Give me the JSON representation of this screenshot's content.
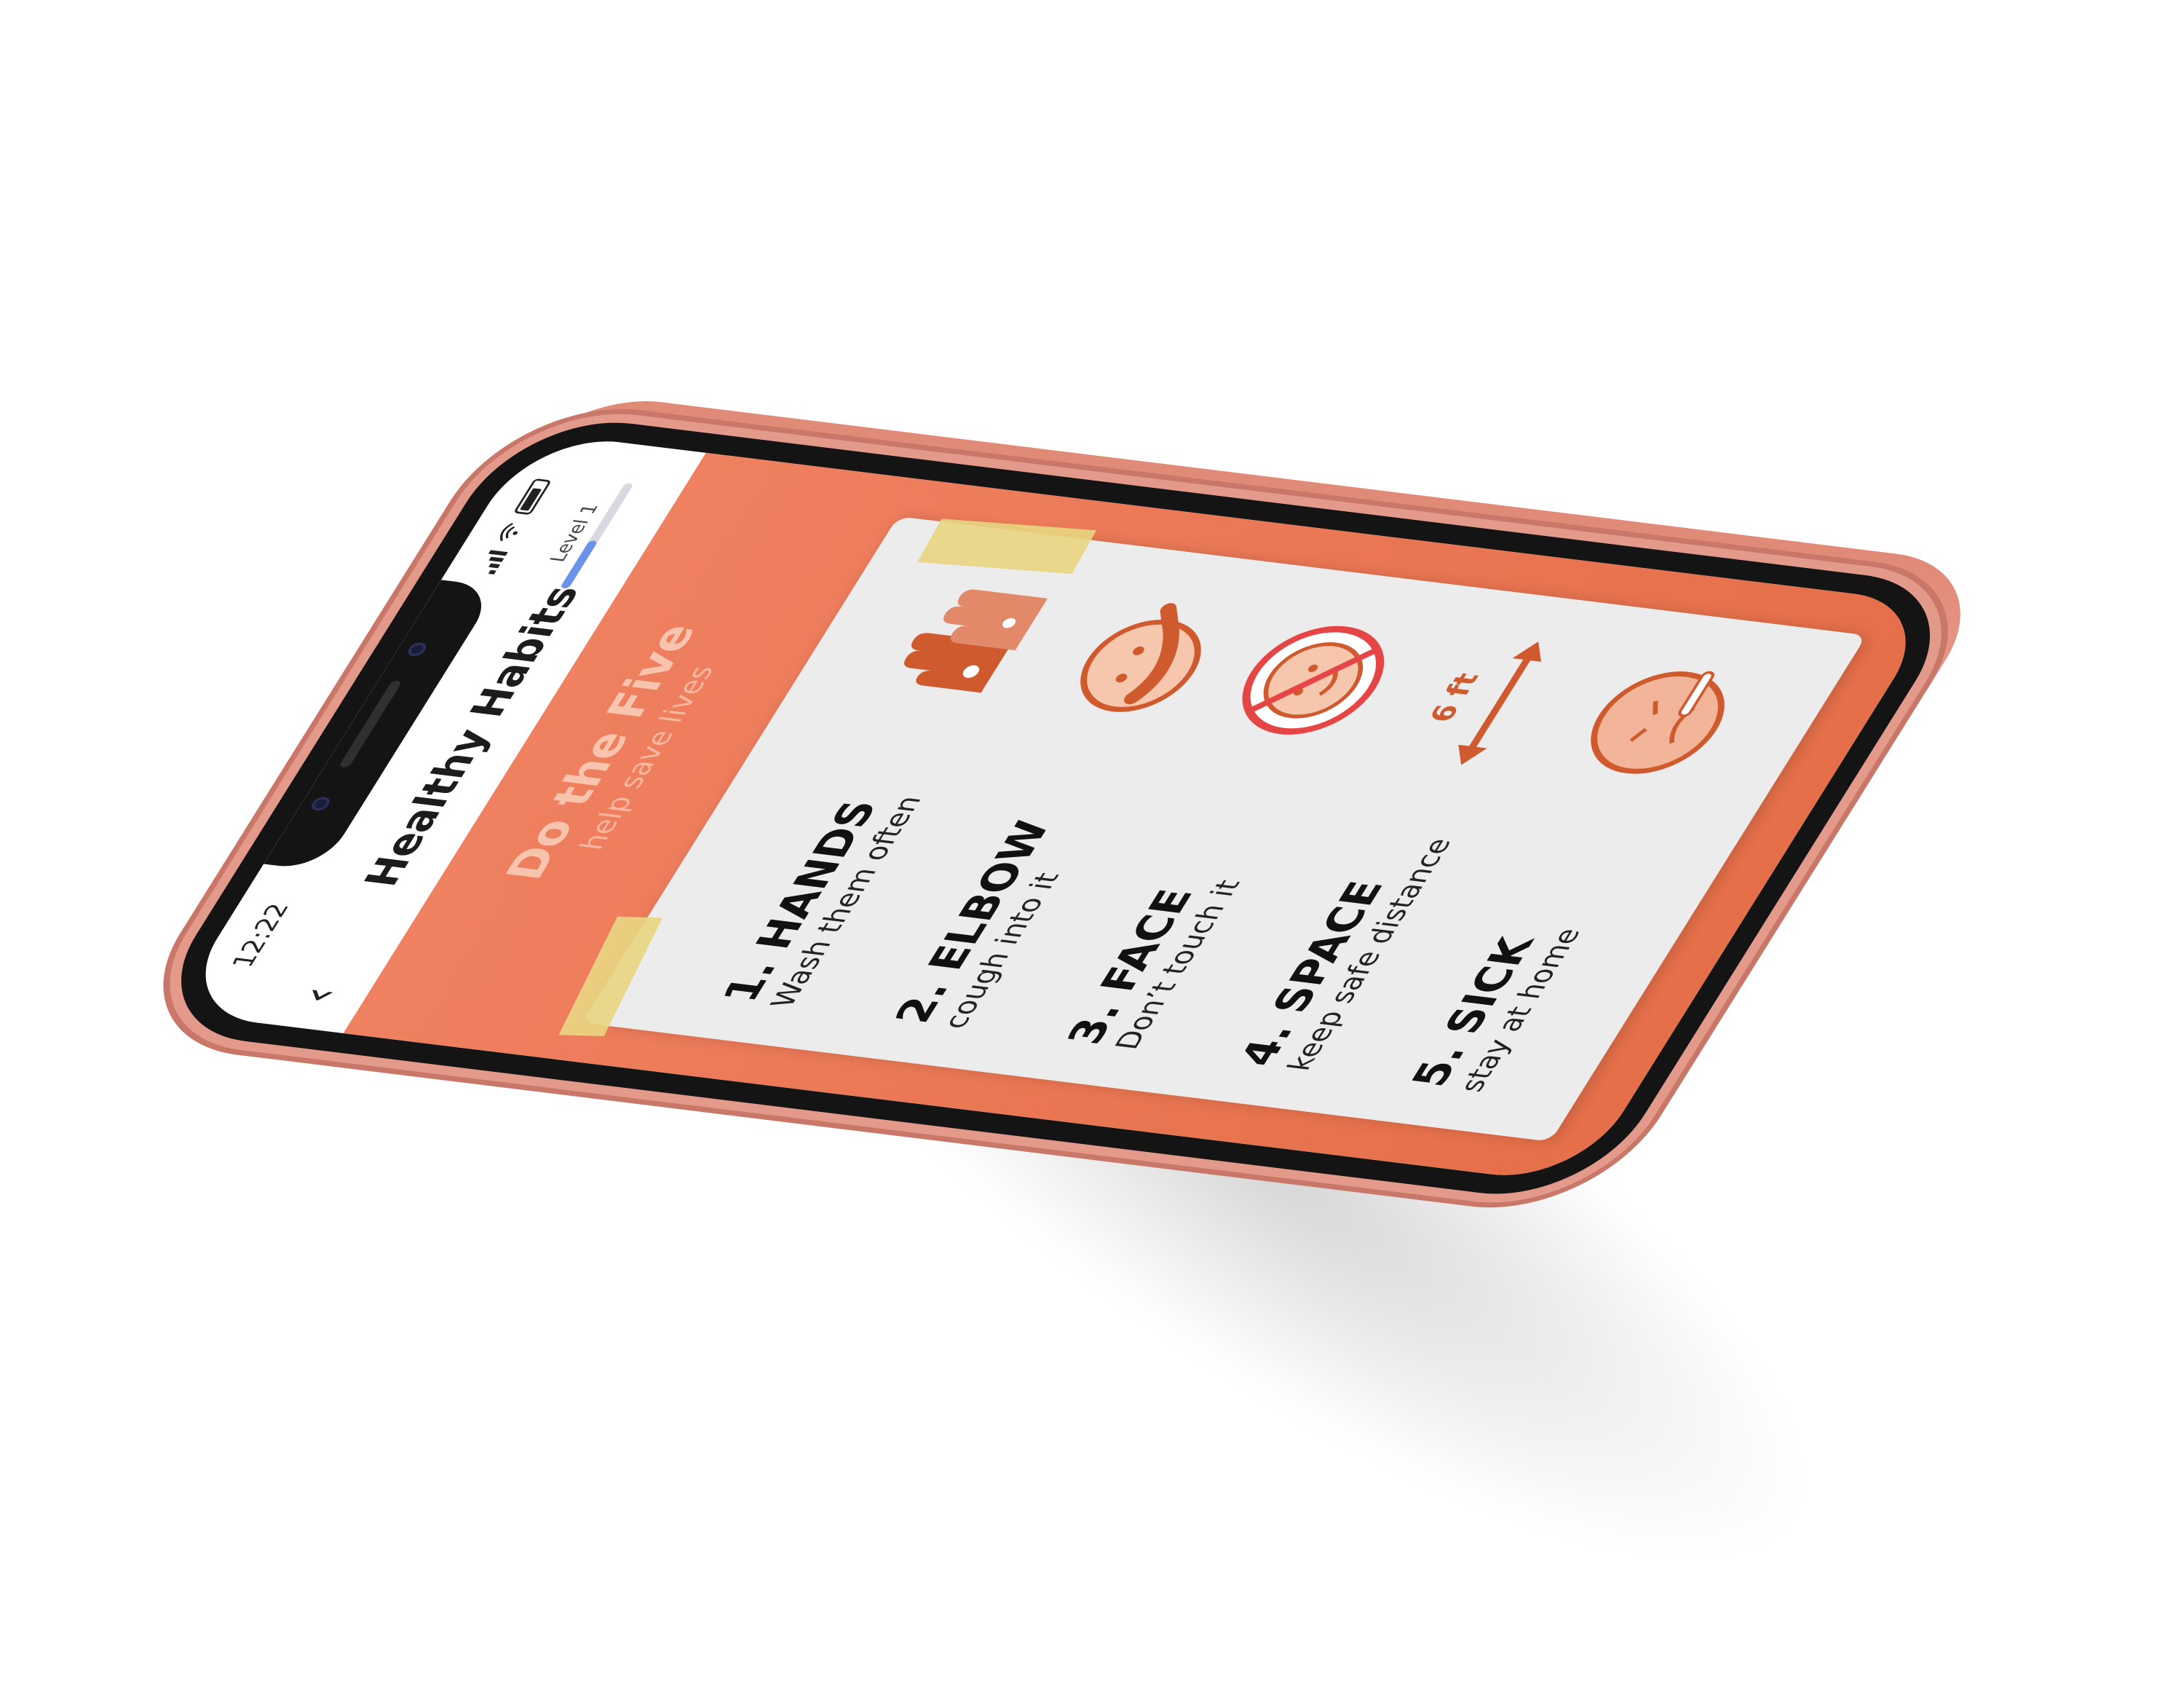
{
  "status": {
    "time": "12:22"
  },
  "nav": {
    "back_icon": "chevron-left-icon",
    "title": "Healthy Habits"
  },
  "level": {
    "label": "Level 1",
    "progress": 0.45
  },
  "banner": {
    "title": "Do the Five",
    "subtitle": "help save lives"
  },
  "steps": [
    {
      "title": "1. HANDS",
      "subtitle": "Wash them often",
      "icon": "hands-washing-icon"
    },
    {
      "title": "2. ELBOW",
      "subtitle": "cough into it",
      "icon": "cough-into-elbow-icon"
    },
    {
      "title": "3. FACE",
      "subtitle": "Don’t touch it",
      "icon": "no-touching-face-icon"
    },
    {
      "title": "4. SPACE",
      "subtitle": "keep safe distance",
      "icon": "distance-arrow-icon",
      "distance_label": "6 ft"
    },
    {
      "title": "5. SICK",
      "subtitle": "stay at home",
      "icon": "sick-face-thermometer-icon"
    }
  ],
  "colors": {
    "accent": "#e56f49",
    "accent_light": "#ef8060",
    "card": "#ececec",
    "tape": "#e9d682",
    "phone_frame": "#e49a8a",
    "progress": "#6a93ea",
    "no_symbol": "#e64545",
    "icon": "#cf5a2e"
  }
}
